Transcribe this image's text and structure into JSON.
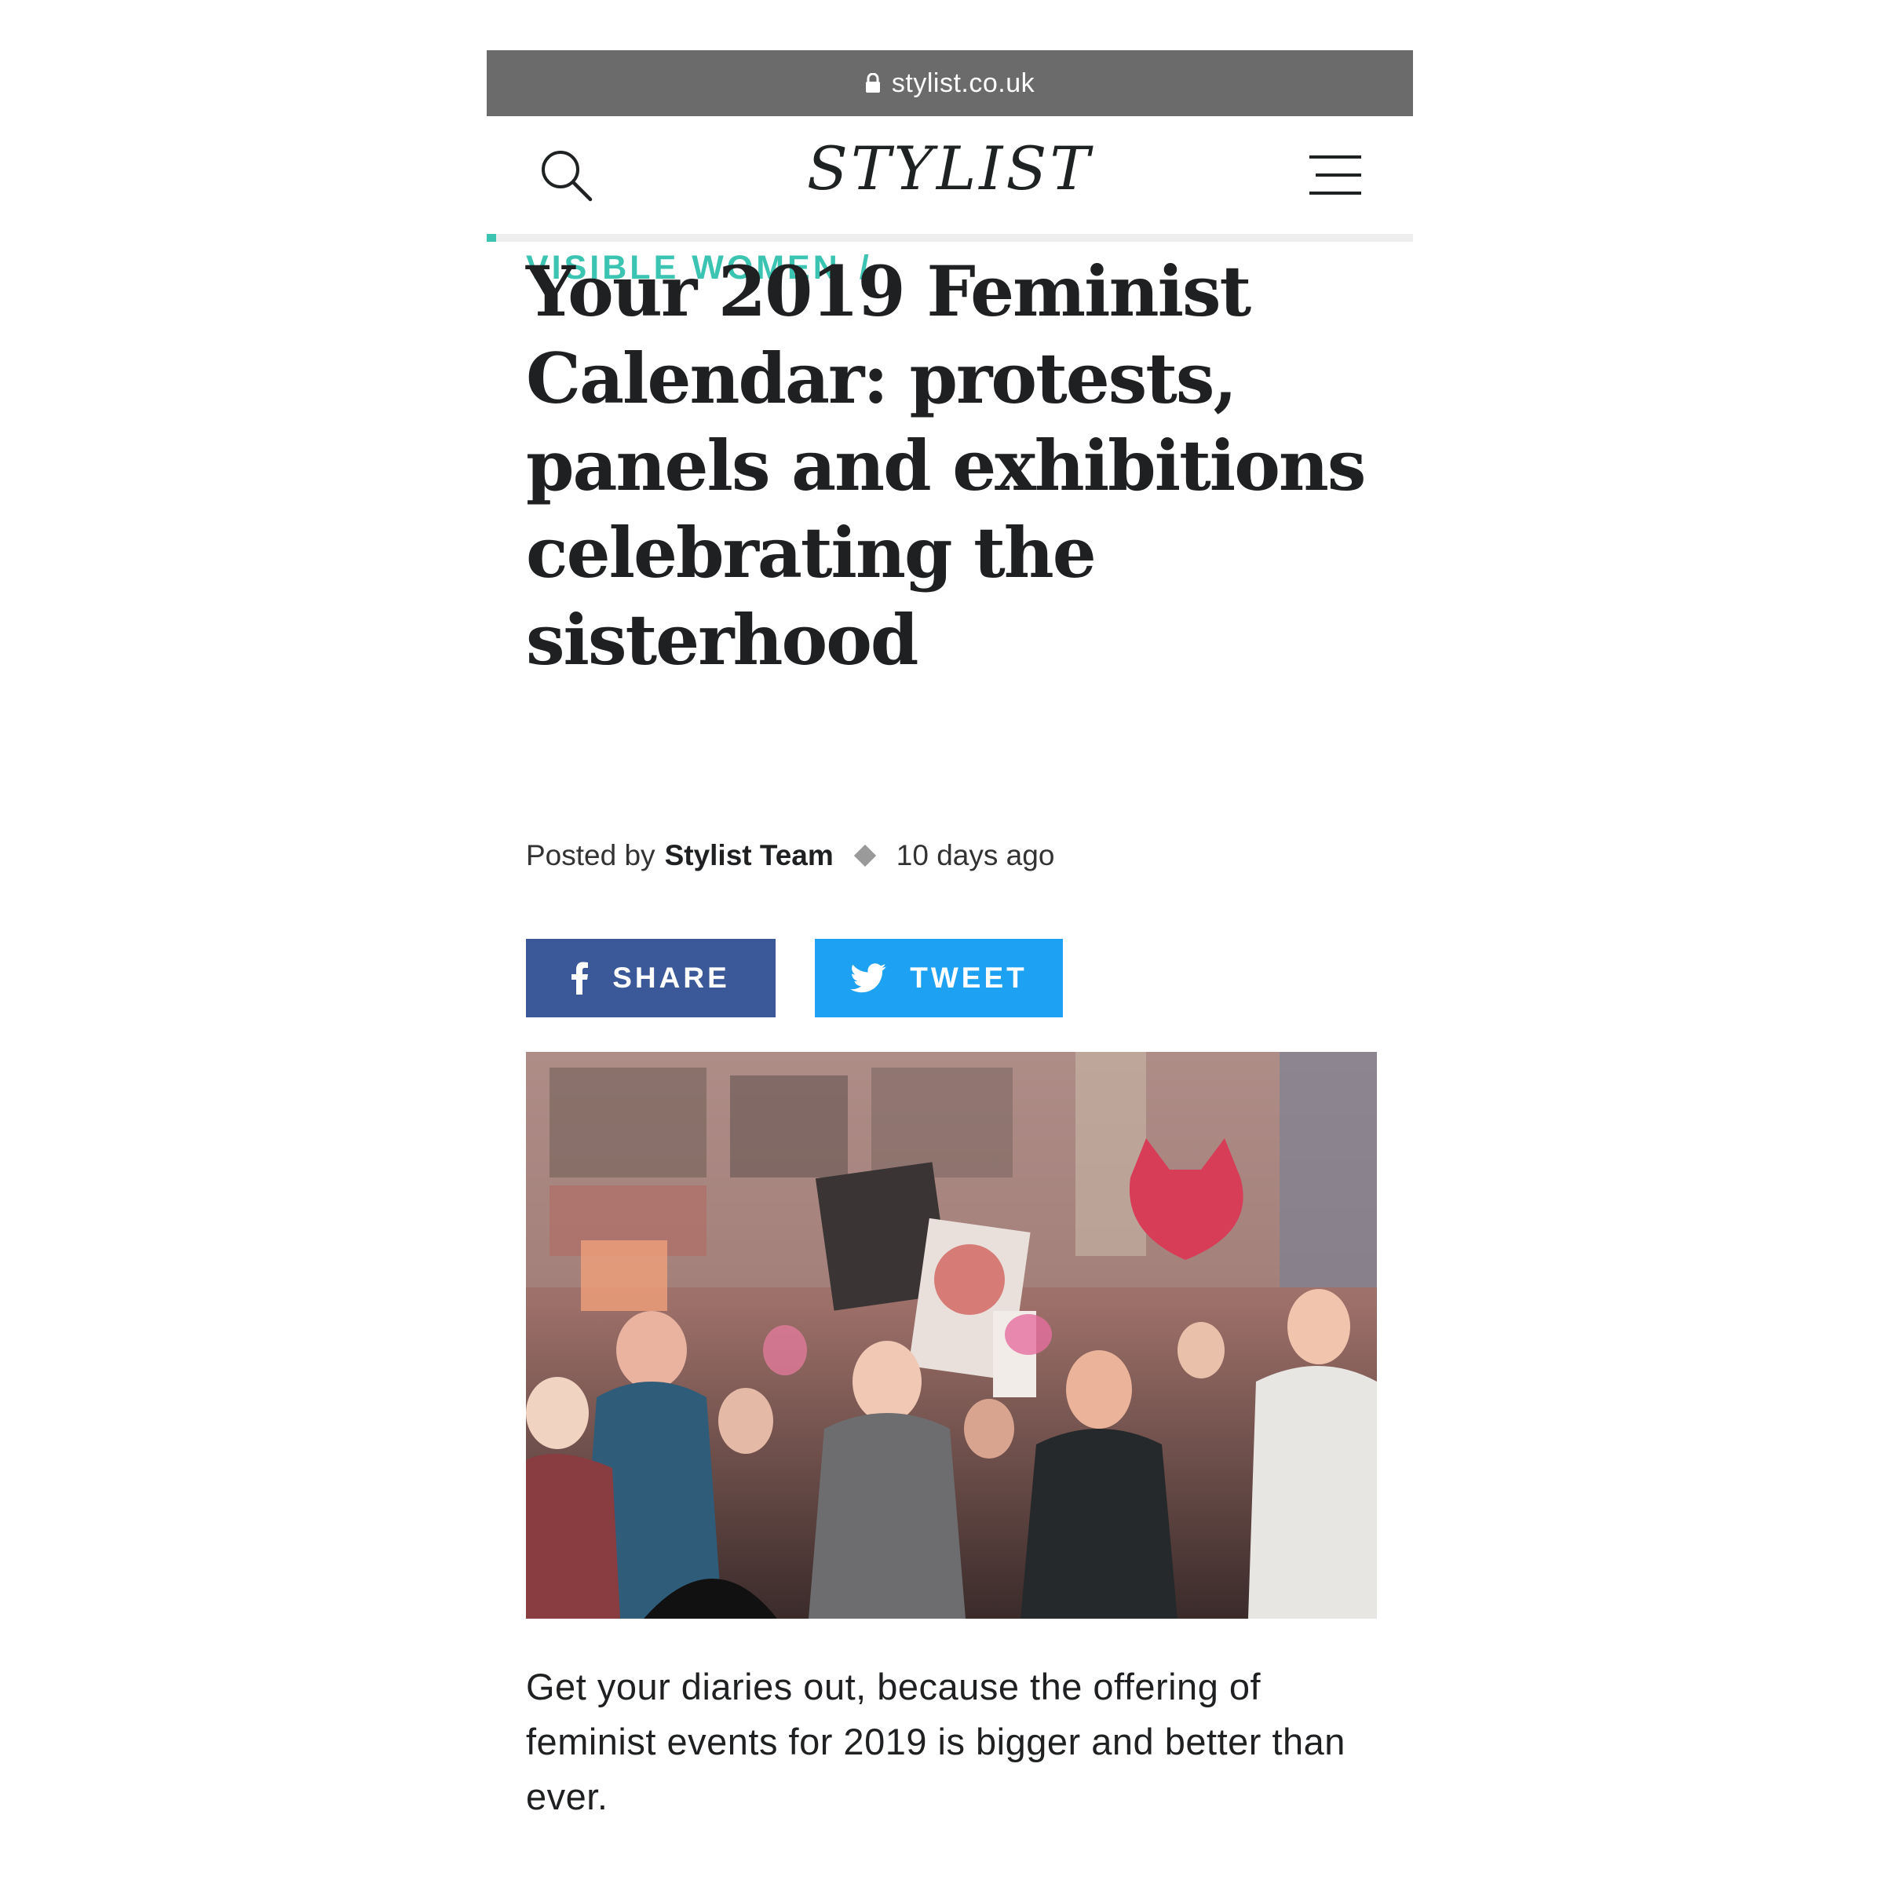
{
  "browser": {
    "url": "stylist.co.uk"
  },
  "header": {
    "logo": "STYLIST"
  },
  "reading_progress": 0.01,
  "article": {
    "category": "VISIBLE WOMEN",
    "category_separator": "/",
    "headline": "Your 2019 Feminist Calendar: protests, panels and exhibitions celebrating the sisterhood",
    "byline": {
      "prefix": "Posted by",
      "author": "Stylist Team",
      "time": "10 days ago"
    },
    "share": {
      "facebook_label": "SHARE",
      "twitter_label": "TWEET"
    },
    "intro": "Get your diaries out, because the offering of feminist events for 2019 is bigger and better than ever."
  },
  "icons": {
    "lock": "lock-icon",
    "search": "search-icon",
    "menu": "hamburger-menu-icon",
    "facebook": "facebook-icon",
    "twitter": "twitter-icon"
  },
  "colors": {
    "urlbar": "#6b6b6b",
    "accent": "#3cc4b2",
    "facebook": "#3b5998",
    "twitter": "#1da1f2",
    "text": "#1e2021"
  }
}
